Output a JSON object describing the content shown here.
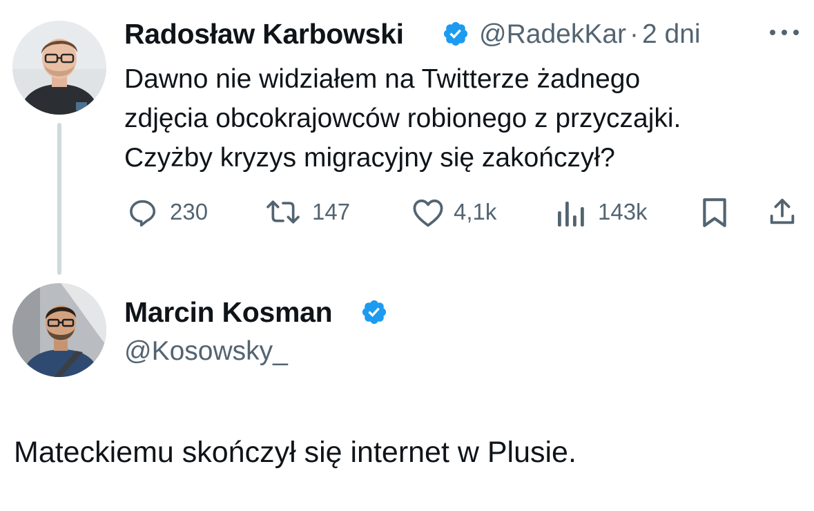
{
  "original_tweet": {
    "author_name": "Radosław Karbowski",
    "handle": "@RadekKar",
    "separator": "·",
    "time": "2 dni",
    "text_lines": [
      "Dawno nie widziałem na Twitterze żadnego",
      "zdjęcia obcokrajowców robionego z przyczajki.",
      "Czyżby kryzys migracyjny się zakończył?"
    ],
    "actions": {
      "replies": "230",
      "retweets": "147",
      "likes": "4,1k",
      "views": "143k"
    },
    "icons": [
      "verified-badge-icon",
      "more-icon",
      "reply-icon",
      "retweet-icon",
      "like-icon",
      "views-icon",
      "bookmark-icon",
      "share-icon"
    ]
  },
  "reply_tweet": {
    "author_name": "Marcin Kosman",
    "handle": "@Kosowsky_",
    "text": "Mateckiemu skończył się internet w Plusie."
  },
  "colors": {
    "verified": "#1d9bf0",
    "secondary_text": "#536471",
    "primary_text": "#0f1419",
    "thread_line": "#cfd9de"
  }
}
